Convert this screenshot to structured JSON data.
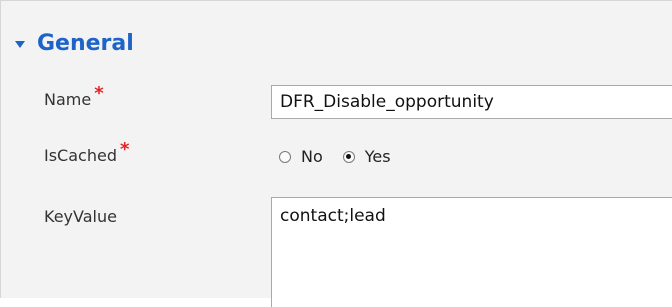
{
  "section": {
    "title": "General"
  },
  "fields": {
    "name": {
      "label": "Name",
      "value": "DFR_Disable_opportunity",
      "required_mark": "*"
    },
    "is_cached": {
      "label": "IsCached",
      "required_mark": "*",
      "options": [
        "No",
        "Yes"
      ],
      "selected": "Yes"
    },
    "key_value": {
      "label": "KeyValue",
      "value": "contact;lead"
    }
  },
  "colors": {
    "accent": "#1e63c8",
    "required": "#e02424"
  }
}
